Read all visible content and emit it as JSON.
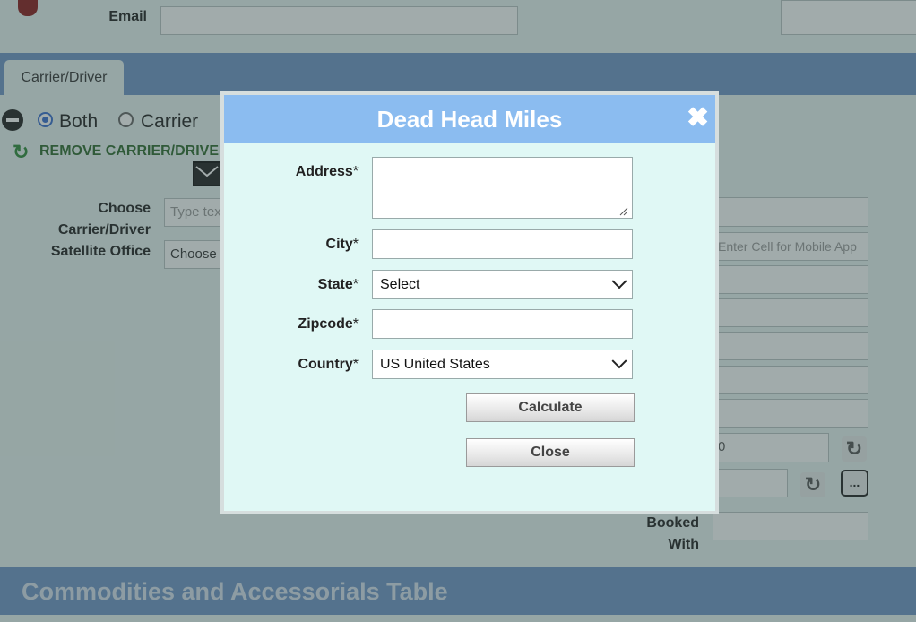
{
  "background": {
    "email_label": "Email",
    "tab_label": "Carrier/Driver",
    "radio_both": "Both",
    "radio_carrier": "Carrier",
    "remove_link": "REMOVE CARRIER/DRIVE",
    "choose_label_1": "Choose",
    "choose_label_2": "Carrier/Driver",
    "satellite_label": "Satellite Office",
    "type_placeholder": "Type tex",
    "choose_select": "Choose",
    "cell_placeholder": "Enter Cell for Mobile App",
    "numeric_value": "0",
    "booked_label_1": "Booked",
    "booked_label_2": "With",
    "footer_title": "Commodities and Accessorials Table",
    "ellipsis": "..."
  },
  "modal": {
    "title": "Dead Head Miles",
    "close_icon": "✖",
    "fields": {
      "address_label": "Address",
      "city_label": "City",
      "state_label": "State",
      "zipcode_label": "Zipcode",
      "country_label": "Country",
      "required_mark": "*",
      "address_value": "",
      "city_value": "",
      "zipcode_value": "",
      "state_selected": "Select",
      "country_selected": "US United States"
    },
    "calculate_label": "Calculate",
    "close_label": "Close"
  },
  "colors": {
    "header_blue": "#8bbcf0",
    "modal_bg": "#e0f8f5",
    "tabbar_blue": "#6f95c6"
  }
}
